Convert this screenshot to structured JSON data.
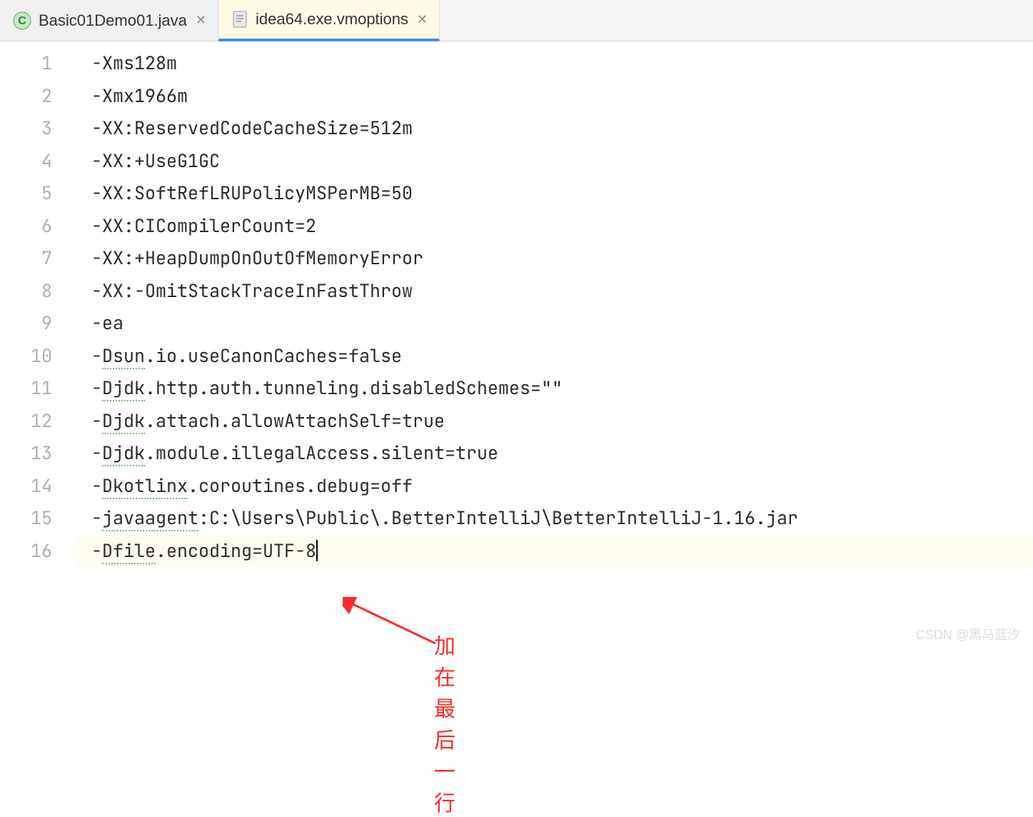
{
  "tabs": [
    {
      "label": "Basic01Demo01.java",
      "icon": "class"
    },
    {
      "label": "idea64.exe.vmoptions",
      "icon": "file"
    }
  ],
  "lines": [
    {
      "n": "1",
      "text": "-Xms128m"
    },
    {
      "n": "2",
      "text": "-Xmx1966m"
    },
    {
      "n": "3",
      "text": "-XX:ReservedCodeCacheSize=512m"
    },
    {
      "n": "4",
      "text": "-XX:+UseG1GC"
    },
    {
      "n": "5",
      "text": "-XX:SoftRefLRUPolicyMSPerMB=50"
    },
    {
      "n": "6",
      "text": "-XX:CICompilerCount=2"
    },
    {
      "n": "7",
      "text": "-XX:+HeapDumpOnOutOfMemoryError"
    },
    {
      "n": "8",
      "text": "-XX:-OmitStackTraceInFastThrow"
    },
    {
      "n": "9",
      "text": "-ea"
    },
    {
      "n": "10",
      "pre": "-",
      "typo": "Dsun",
      "post": ".io.useCanonCaches=false"
    },
    {
      "n": "11",
      "pre": "-",
      "typo": "Djdk",
      "post": ".http.auth.tunneling.disabledSchemes=\"\""
    },
    {
      "n": "12",
      "pre": "-",
      "typo": "Djdk",
      "post": ".attach.allowAttachSelf=true"
    },
    {
      "n": "13",
      "pre": "-",
      "typo": "Djdk",
      "post": ".module.illegalAccess.silent=true"
    },
    {
      "n": "14",
      "pre": "-",
      "typo": "Dkotlinx",
      "post": ".coroutines.debug=off"
    },
    {
      "n": "15",
      "pre": "-",
      "typo": "javaagent",
      "post": ":C:\\Users\\Public\\.BetterIntelliJ\\BetterIntelliJ-1.16.jar"
    },
    {
      "n": "16",
      "pre": "-",
      "typo": "Dfile",
      "post": ".encoding=UTF-8",
      "hl": true,
      "caret": true
    }
  ],
  "annotation": "加在最后一行",
  "watermark": "CSDN @黑马蓝汐"
}
